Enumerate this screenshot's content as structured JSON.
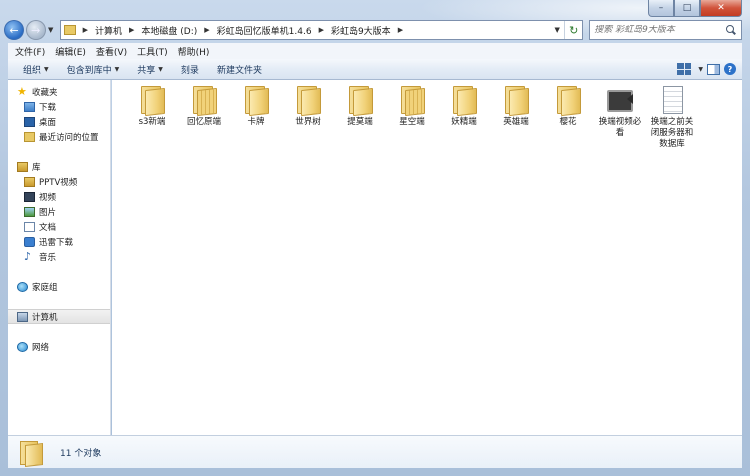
{
  "window": {
    "caption": {
      "minimize": "–",
      "maximize": "□",
      "close": "✕"
    }
  },
  "nav": {
    "back_glyph": "←",
    "forward_glyph": "→",
    "breadcrumbs": [
      "计算机",
      "本地磁盘 (D:)",
      "彩虹岛回忆版单机1.4.6",
      "彩虹岛9大版本"
    ],
    "refresh_glyph": "↻"
  },
  "search": {
    "placeholder": "搜索 彩虹岛9大版本"
  },
  "menubar": {
    "items": [
      "文件(F)",
      "编辑(E)",
      "查看(V)",
      "工具(T)",
      "帮助(H)"
    ]
  },
  "toolbar": {
    "organize": "组织",
    "include_library": "包含到库中",
    "share": "共享",
    "burn": "刻录",
    "new_folder": "新建文件夹",
    "help": "?"
  },
  "navpane": {
    "favorites": {
      "label": "收藏夹",
      "items": [
        "下载",
        "桌面",
        "最近访问的位置"
      ]
    },
    "libraries": {
      "label": "库",
      "items": [
        "PPTV视频",
        "视频",
        "图片",
        "文档",
        "迅雷下载",
        "音乐"
      ]
    },
    "homegroup": "家庭组",
    "computer": "计算机",
    "network": "网络"
  },
  "files": [
    {
      "name": "s3新端",
      "type": "folder"
    },
    {
      "name": "回忆原端",
      "type": "folder-full"
    },
    {
      "name": "卡牌",
      "type": "folder"
    },
    {
      "name": "世界树",
      "type": "folder"
    },
    {
      "name": "提莫端",
      "type": "folder"
    },
    {
      "name": "星空端",
      "type": "folder-full"
    },
    {
      "name": "妖精端",
      "type": "folder"
    },
    {
      "name": "英雄端",
      "type": "folder"
    },
    {
      "name": "樱花",
      "type": "folder"
    },
    {
      "name": "换端视频必看",
      "type": "video"
    },
    {
      "name": "换端之前关闭服务器和数据库",
      "type": "doc"
    }
  ],
  "details": {
    "count": "11 个对象"
  }
}
